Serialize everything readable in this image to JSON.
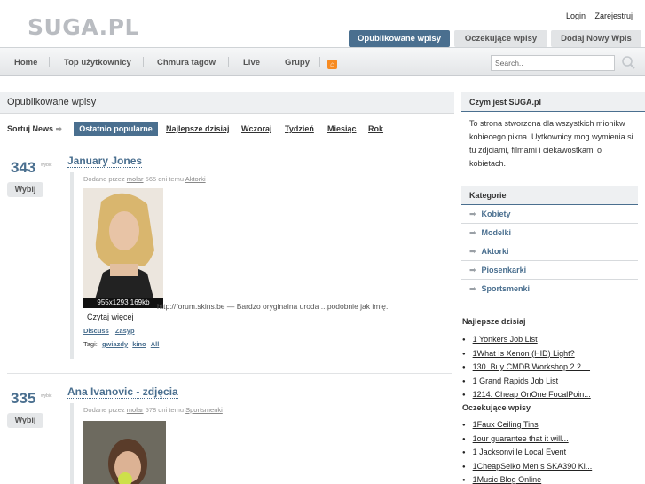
{
  "header": {
    "logo": "SUGA.PL",
    "login": "Login",
    "register": "Zarejestruj",
    "tabs": [
      "Opublikowane wpisy",
      "Oczekujące wpisy",
      "Dodaj Nowy Wpis"
    ]
  },
  "nav": {
    "items": [
      "Home",
      "Top użytkownicy",
      "Chmura tagow",
      "Live",
      "Grupy"
    ],
    "search_placeholder": "Search.."
  },
  "main": {
    "title": "Opublikowane wpisy",
    "sort_label": "Sortuj News",
    "sort_active": "Ostatnio popularne",
    "sort_links": [
      "Najlepsze dzisiaj",
      "Wczoraj",
      "Tydzień",
      "Miesiąc",
      "Rok"
    ],
    "entries": [
      {
        "votes": "343",
        "votes_unit": "wybić",
        "vote_button": "Wybij",
        "title": "January Jones",
        "meta_prefix": "Dodane przez",
        "author": "molar",
        "meta_time": "565 dni temu",
        "category": "Aktorki",
        "image_info": "955x1293 169kb",
        "caption": "http://forum.skins.be — Bardzo oryginalna uroda ...podobnie jak imię.",
        "read_more": "Czytaj więcej",
        "links": [
          "Discuss",
          "Zasyp"
        ],
        "tags_label": "Tagi:",
        "tags": [
          "gwiazdy",
          "kino",
          "All"
        ]
      },
      {
        "votes": "335",
        "votes_unit": "wybić",
        "vote_button": "Wybij",
        "title": "Ana Ivanovic - zdjęcia",
        "meta_prefix": "Dodane przez",
        "author": "molar",
        "meta_time": "578 dni temu",
        "category": "Sportsmenki"
      }
    ]
  },
  "sidebar": {
    "about_title": "Czym jest SUGA.pl",
    "about_text": "To strona stworzona dla wszystkich mionikw kobiecego pikna. Uytkownicy mog wymienia si tu zdjciami, filmami i ciekawostkami o kobietach.",
    "categories_title": "Kategorie",
    "categories": [
      "Kobiety",
      "Modelki",
      "Aktorki",
      "Piosenkarki",
      "Sportsmenki"
    ],
    "best_today_title": "Najlepsze dzisiaj",
    "best_today": [
      "1 Yonkers Job List",
      "1What Is Xenon (HID) Light?",
      "130. Buy CMDB Workshop 2.2 ...",
      "1 Grand Rapids Job List",
      "1214. Cheap OnOne FocalPoin..."
    ],
    "pending_title": "Oczekujące wpisy",
    "pending": [
      "1Faux Ceiling Tins",
      "1our guarantee that it will...",
      "1 Jacksonville Local Event",
      "1CheapSeiko Men s SKA390 Ki...",
      "1Music Blog Online"
    ]
  },
  "colors": {
    "accent": "#4a6f8f",
    "rss": "#f78b22"
  }
}
